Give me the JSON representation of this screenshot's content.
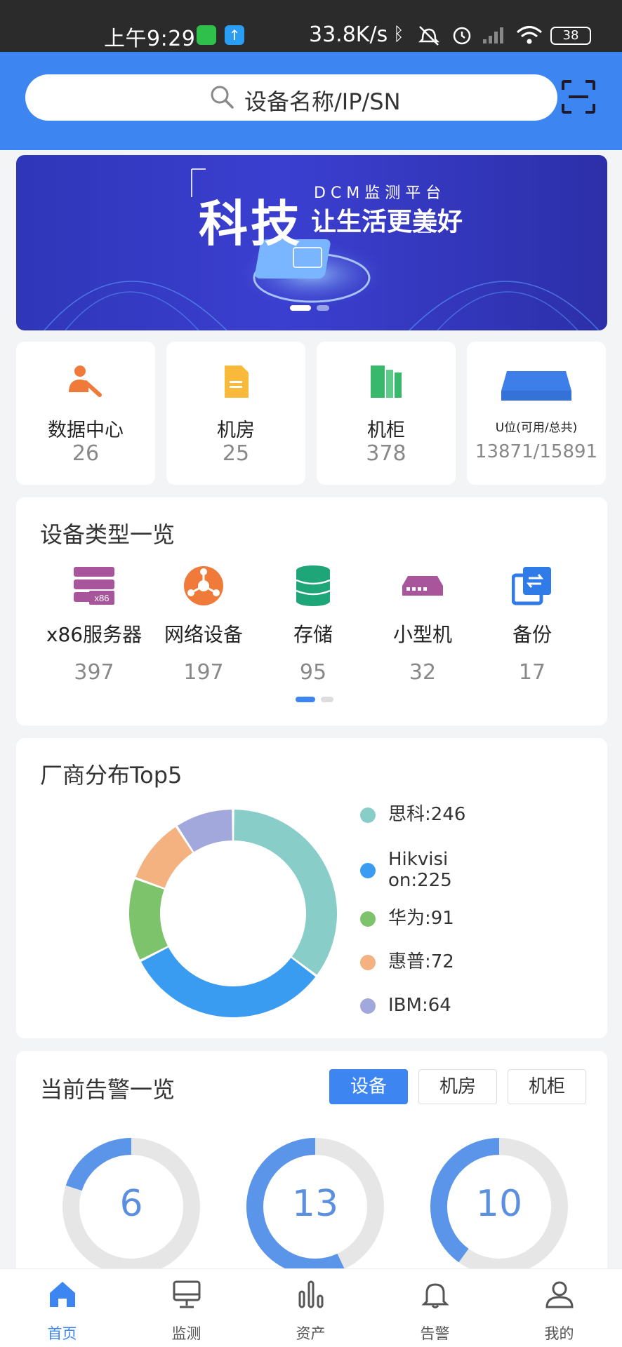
{
  "status_bar": {
    "time": "上午9:29",
    "network_speed": "33.8K/s",
    "battery": "38",
    "icons": [
      "wechat-icon",
      "upload-icon",
      "bluetooth-icon",
      "mute-icon",
      "alarm-icon",
      "signal-icon",
      "wifi-icon",
      "battery-icon"
    ]
  },
  "header": {
    "search_placeholder": "设备名称/IP/SN",
    "scan_icon": "scan-icon",
    "color": "#3d86f2"
  },
  "banner": {
    "title": "科技",
    "subtitle_top": "DCM监测平台",
    "subtitle_bottom": "让生活更美好"
  },
  "stats": [
    {
      "label": "数据中心",
      "value": "26",
      "icon": "datacenter-icon"
    },
    {
      "label": "机房",
      "value": "25",
      "icon": "room-icon"
    },
    {
      "label": "机柜",
      "value": "378",
      "icon": "cabinet-icon"
    },
    {
      "label": "U位(可用/总共)",
      "value": "13871/15891",
      "icon": "u-slot-icon"
    }
  ],
  "device_types": {
    "title": "设备类型一览",
    "items": [
      {
        "label": "x86服务器",
        "value": "397",
        "icon": "x86-server-icon",
        "badge": "x86"
      },
      {
        "label": "网络设备",
        "value": "197",
        "icon": "network-device-icon"
      },
      {
        "label": "存储",
        "value": "95",
        "icon": "storage-icon"
      },
      {
        "label": "小型机",
        "value": "32",
        "icon": "minicomputer-icon"
      },
      {
        "label": "备份",
        "value": "17",
        "icon": "backup-icon"
      }
    ]
  },
  "vendors": {
    "title": "厂商分布Top5",
    "chart_data": {
      "type": "pie",
      "categories": [
        "思科",
        "Hikvision",
        "华为",
        "惠普",
        "IBM"
      ],
      "values": [
        246,
        225,
        91,
        72,
        64
      ],
      "colors": [
        "#88cdc8",
        "#3a9cf0",
        "#7cc36c",
        "#f3b27f",
        "#a3a8dc"
      ],
      "legend": "right"
    },
    "legend": [
      {
        "text_line1": "思科:246"
      },
      {
        "text_line1": "Hikvisi",
        "text_line2": "on:225"
      },
      {
        "text_line1": "华为:91"
      },
      {
        "text_line1": "惠普:72"
      },
      {
        "text_line1": "IBM:64"
      }
    ]
  },
  "alarms": {
    "title": "当前告警一览",
    "tabs": [
      {
        "label": "设备",
        "active": true
      },
      {
        "label": "机房",
        "active": false
      },
      {
        "label": "机柜",
        "active": false
      }
    ],
    "rings": [
      {
        "value": "6",
        "fraction": 0.2
      },
      {
        "value": "13",
        "fraction": 0.57
      },
      {
        "value": "10",
        "fraction": 0.4
      }
    ]
  },
  "bottom_nav": [
    {
      "label": "首页",
      "icon": "home-icon",
      "active": true
    },
    {
      "label": "监测",
      "icon": "monitor-icon",
      "active": false
    },
    {
      "label": "资产",
      "icon": "assets-icon",
      "active": false
    },
    {
      "label": "告警",
      "icon": "bell-icon",
      "active": false
    },
    {
      "label": "我的",
      "icon": "user-icon",
      "active": false
    }
  ]
}
